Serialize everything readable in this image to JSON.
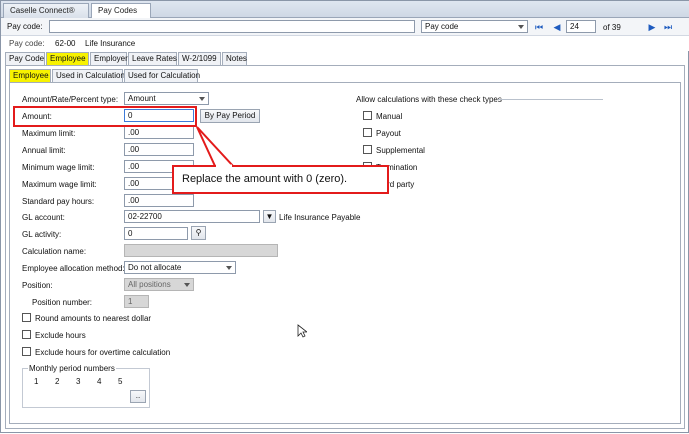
{
  "window_tabs": [
    {
      "label": "Caselle Connect®"
    },
    {
      "label": "Pay Codes"
    }
  ],
  "toolbar": {
    "pay_code_label": "Pay code:",
    "pay_code_value": "",
    "lookup_type": "Pay code",
    "record_number": "24",
    "record_total": "of 39"
  },
  "header": {
    "pay_code_label": "Pay code:",
    "pay_code_number": "62-00",
    "pay_code_name": "Life Insurance"
  },
  "main_tabs": [
    "Pay Code",
    "Employee",
    "Employer",
    "Leave Rates",
    "W-2/1099",
    "Notes"
  ],
  "sub_tabs": [
    "Employee",
    "Used in Calculations",
    "Used for Calculation"
  ],
  "form": {
    "amount_type_label": "Amount/Rate/Percent type:",
    "amount_type_value": "Amount",
    "amount_label": "Amount:",
    "amount_value": "0",
    "by_pay_period_label": "By Pay Period",
    "maximum_limit_label": "Maximum limit:",
    "maximum_limit_value": ".00",
    "annual_limit_label": "Annual limit:",
    "annual_limit_value": ".00",
    "min_wage_limit_label": "Minimum wage limit:",
    "min_wage_limit_value": ".00",
    "max_wage_limit_label": "Maximum wage limit:",
    "max_wage_limit_value": ".00",
    "standard_pay_hours_label": "Standard pay hours:",
    "standard_pay_hours_value": ".00",
    "gl_account_label": "GL account:",
    "gl_account_value": "02-22700",
    "gl_account_desc": "Life Insurance Payable",
    "gl_activity_label": "GL activity:",
    "gl_activity_value": "0",
    "calculation_name_label": "Calculation name:",
    "calculation_name_value": "",
    "allocation_method_label": "Employee allocation method:",
    "allocation_method_value": "Do not allocate",
    "position_label": "Position:",
    "position_value": "All positions",
    "position_number_label": "Position number:",
    "position_number_value": "1",
    "round_label": "Round amounts to nearest dollar",
    "exclude_hours_label": "Exclude hours",
    "exclude_ot_label": "Exclude hours for overtime calculation",
    "monthly_group_label": "Monthly period numbers",
    "monthly_periods": [
      "1",
      "2",
      "3",
      "4",
      "5"
    ],
    "more_button": ".."
  },
  "check_types": {
    "title": "Allow calculations with these check types",
    "items": [
      "Manual",
      "Payout",
      "Supplemental",
      "Termination",
      "Third party"
    ]
  },
  "callout": {
    "text": "Replace the amount with 0 (zero)."
  },
  "colors": {
    "highlight": "#f7f200",
    "annotation": "#e31b1b",
    "nav_blue": "#1e5bbf"
  }
}
